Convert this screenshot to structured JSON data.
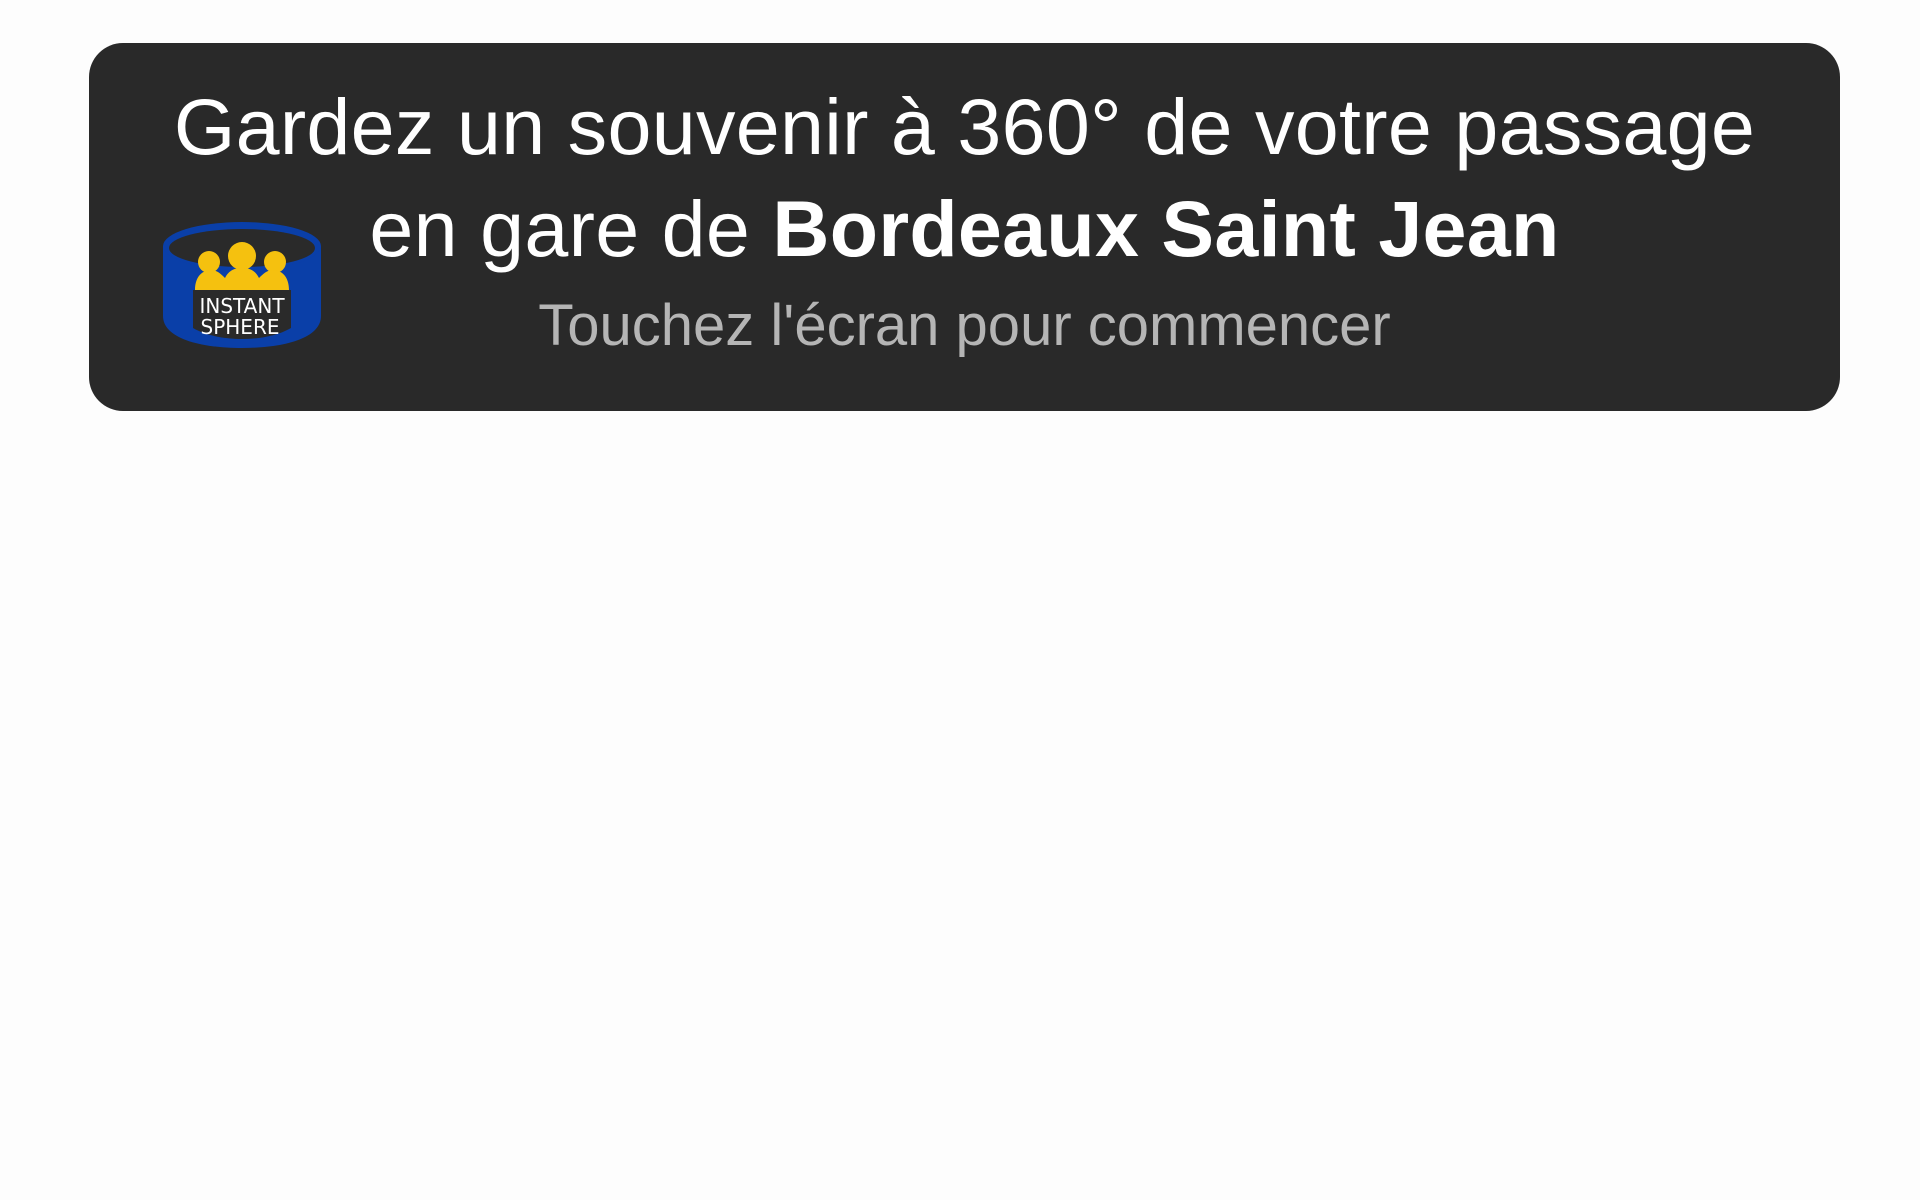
{
  "banner": {
    "title_line1": "Gardez un souvenir à 360° de votre passage",
    "title_line2_prefix": "en gare de ",
    "title_line2_station": "Bordeaux Saint Jean",
    "subtitle": "Touchez l'écran pour commencer"
  },
  "logo": {
    "icon": "instant-sphere-logo",
    "text_line1": "INSTANT",
    "text_line2": "SPHERE",
    "colors": {
      "ring": "#0a3fa8",
      "people": "#f5c10f",
      "inner": "#2a2a2a"
    }
  },
  "colors": {
    "background": "#fdfdfd",
    "banner": "#292929",
    "title": "#ffffff",
    "subtitle": "#b5b5b5"
  }
}
